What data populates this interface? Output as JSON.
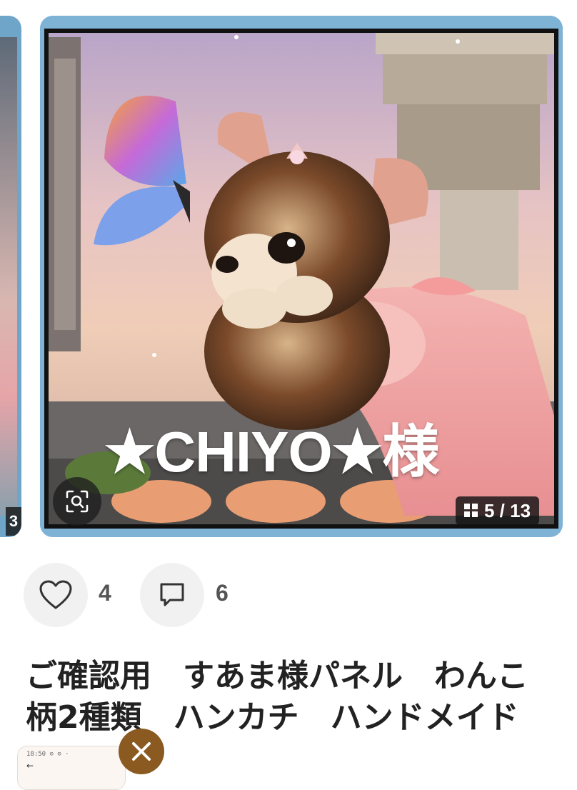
{
  "gallery": {
    "caption": "★CHIYO★様",
    "counter": "5 / 13",
    "prev_counter_stub": "3"
  },
  "actions": {
    "like_count": "4",
    "comment_count": "6"
  },
  "product": {
    "title_line1": "ご確認用　すあま様パネル　わんこ",
    "title_line2": "柄2種類　ハンカチ　ハンドメイド"
  },
  "mini_player": {
    "status_text": "18:50 ⊙ ⊙ ·",
    "back_glyph": "←"
  },
  "icons": {
    "zoom": "zoom-scan-icon",
    "grid": "grid-icon",
    "like": "heart-icon",
    "comment": "comment-icon",
    "close": "close-icon"
  },
  "colors": {
    "close_button": "#8a5a20",
    "action_bg": "#f1f1f1",
    "text": "#222222"
  }
}
